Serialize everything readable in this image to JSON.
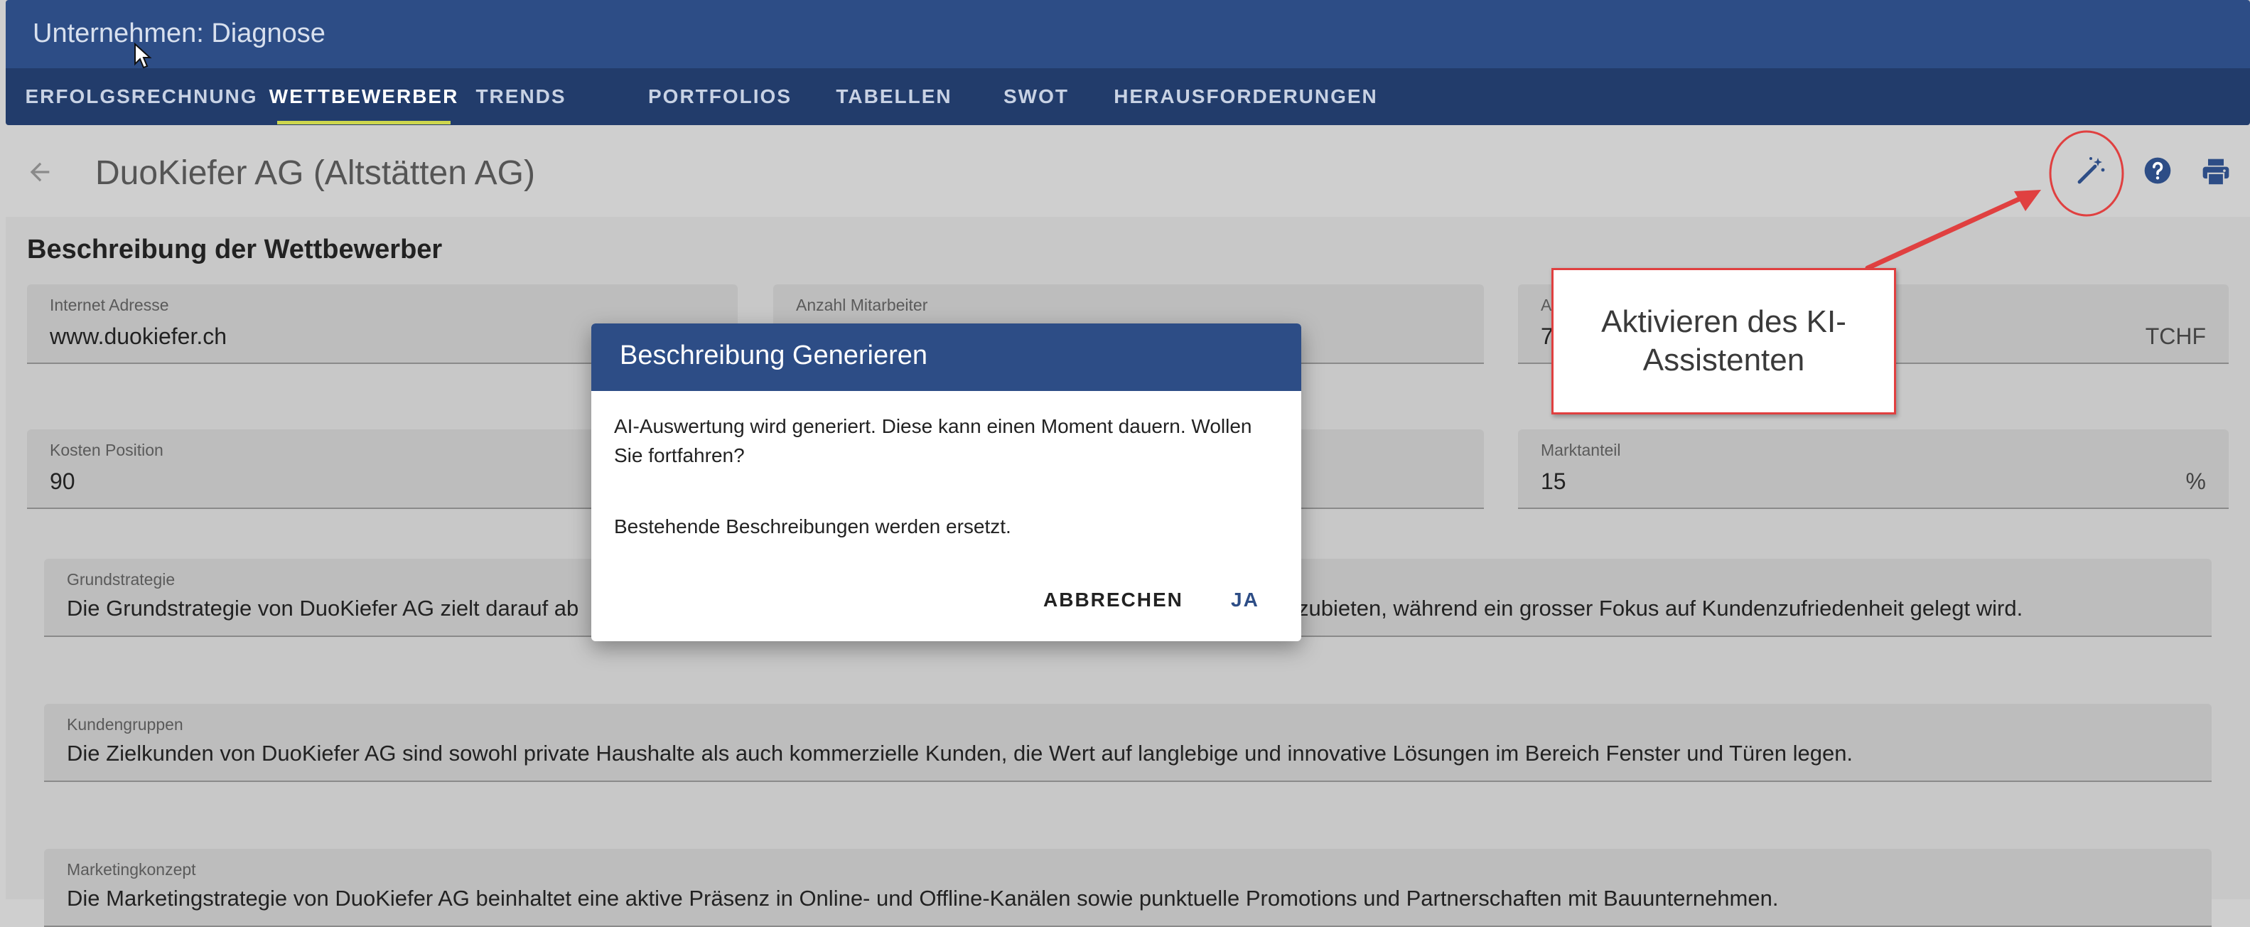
{
  "app": {
    "title": "Unternehmen: Diagnose"
  },
  "tabs": [
    {
      "label": "ERFOLGSRECHNUNG"
    },
    {
      "label": "WETTBEWERBER",
      "active": true
    },
    {
      "label": "TRENDS"
    },
    {
      "label": "PORTFOLIOS"
    },
    {
      "label": "TABELLEN"
    },
    {
      "label": "SWOT"
    },
    {
      "label": "HERAUSFORDERUNGEN"
    }
  ],
  "header": {
    "company": "DuoKiefer AG (Altstätten AG)",
    "icons": [
      "back-arrow-icon",
      "magic-wand-icon",
      "help-icon",
      "print-icon"
    ]
  },
  "section": {
    "title": "Beschreibung der Wettbewerber"
  },
  "fields": {
    "internet": {
      "label": "Internet Adresse",
      "value": "www.duokiefer.ch"
    },
    "employees": {
      "label": "Anzahl Mitarbeiter",
      "value": ""
    },
    "revenue": {
      "label": "A",
      "value": "7",
      "unit": "TCHF"
    },
    "cost_position": {
      "label": "Kosten Position",
      "value": "90"
    },
    "market_share": {
      "label": "Marktanteil",
      "value": "15",
      "unit": "%"
    },
    "strategy": {
      "label": "Grundstrategie",
      "value_left": "Die Grundstrategie von DuoKiefer AG zielt darauf ab",
      "value_right": "zubieten, während ein grosser Fokus auf Kundenzufriedenheit gelegt wird."
    },
    "customers": {
      "label": "Kundengruppen",
      "value": "Die Zielkunden von DuoKiefer AG sind sowohl private Haushalte als auch kommerzielle Kunden, die Wert auf langlebige und innovative Lösungen im Bereich Fenster und Türen legen."
    },
    "marketing": {
      "label": "Marketingkonzept",
      "value": "Die Marketingstrategie von DuoKiefer AG beinhaltet eine aktive Präsenz in Online- und Offline-Kanälen sowie punktuelle Promotions und Partnerschaften mit Bauunternehmen."
    }
  },
  "dialog": {
    "title": "Beschreibung Generieren",
    "message": "AI-Auswertung wird generiert. Diese kann einen Moment dauern. Wollen Sie fortfahren?",
    "note": "Bestehende Beschreibungen werden ersetzt.",
    "cancel_label": "ABBRECHEN",
    "confirm_label": "JA"
  },
  "annotation": {
    "text": "Aktivieren des KI-Assistenten"
  },
  "colors": {
    "primary": "#2d4d86",
    "tabbar": "#223c6b",
    "tab_indicator": "#cdd64e",
    "annotation": "#e04040"
  }
}
